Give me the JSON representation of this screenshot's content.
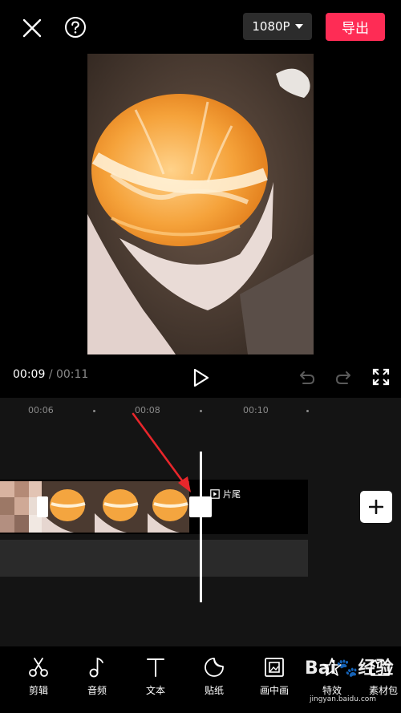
{
  "topbar": {
    "resolution": "1080P",
    "export_label": "导出"
  },
  "player": {
    "current_time": "00:09",
    "separator": "/",
    "total_time": "00:11"
  },
  "timeline": {
    "ruler": [
      "00:06",
      "00:08",
      "00:10"
    ],
    "ending_label": "片尾"
  },
  "toolbar": {
    "items": [
      {
        "label": "剪辑",
        "icon": "scissors-icon"
      },
      {
        "label": "音频",
        "icon": "music-note-icon"
      },
      {
        "label": "文本",
        "icon": "text-icon"
      },
      {
        "label": "贴纸",
        "icon": "sticker-icon"
      },
      {
        "label": "画中画",
        "icon": "picture-in-picture-icon"
      },
      {
        "label": "特效",
        "icon": "effects-star-icon"
      },
      {
        "label": "素材包",
        "icon": "material-pack-icon"
      }
    ]
  },
  "watermark": {
    "brand": "Bai🐾经验",
    "url": "jingyan.baidu.com"
  },
  "colors": {
    "accent": "#fe2c55",
    "timeline_bg": "#141414",
    "annotation_arrow": "#e8262b"
  }
}
